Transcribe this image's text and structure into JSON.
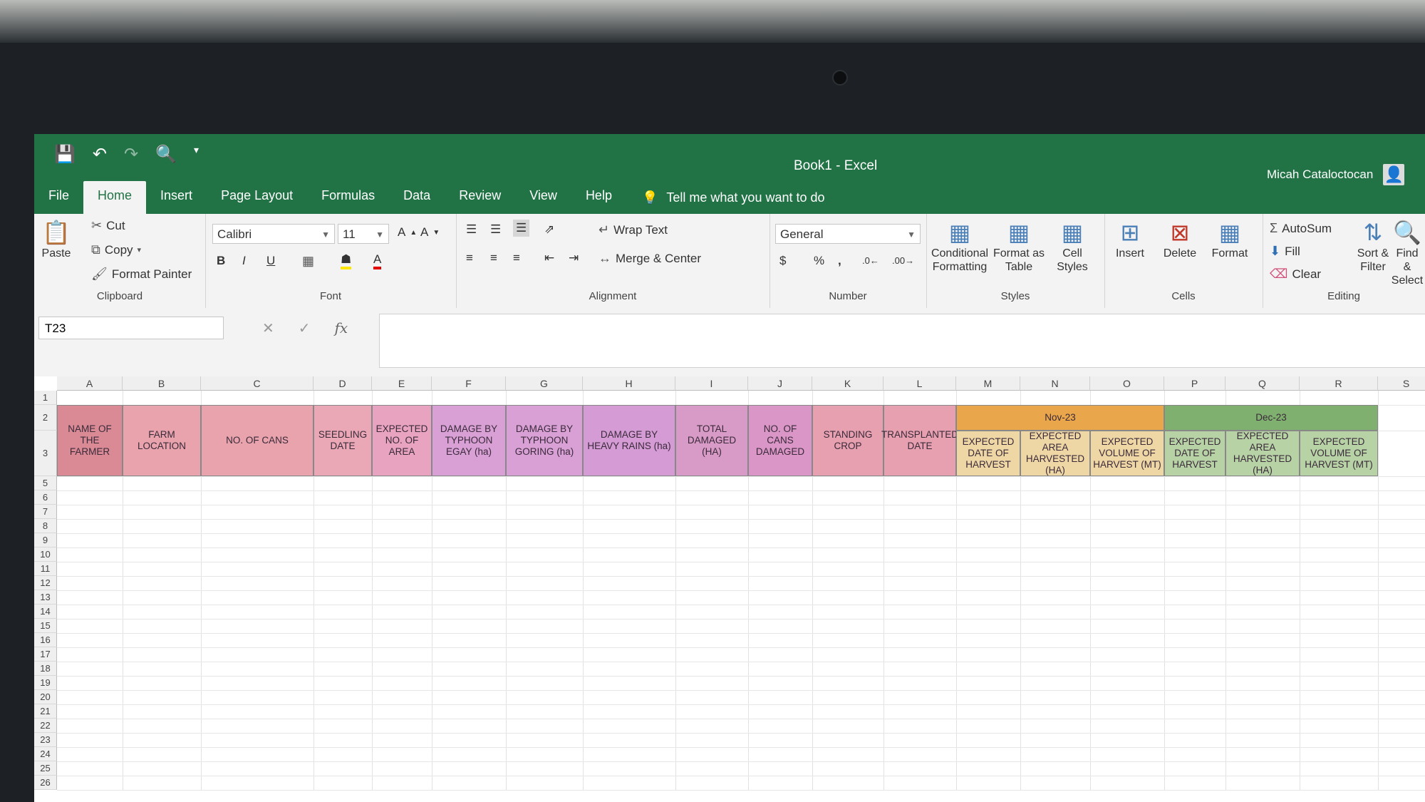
{
  "window": {
    "title": "Book1  -  Excel",
    "user": "Micah Cataloctocan"
  },
  "tabs": [
    "File",
    "Home",
    "Insert",
    "Page Layout",
    "Formulas",
    "Data",
    "Review",
    "View",
    "Help"
  ],
  "tell_me": "Tell me what you want to do",
  "clipboard": {
    "paste": "Paste",
    "cut": "Cut",
    "copy": "Copy",
    "format_painter": "Format Painter",
    "label": "Clipboard"
  },
  "font": {
    "name": "Calibri",
    "size": "11",
    "label": "Font"
  },
  "alignment": {
    "wrap": "Wrap Text",
    "merge": "Merge & Center",
    "label": "Alignment"
  },
  "number": {
    "format": "General",
    "label": "Number"
  },
  "styles": {
    "conditional": "Conditional Formatting",
    "format_table": "Format as Table",
    "cell_styles": "Cell Styles",
    "label": "Styles"
  },
  "cells": {
    "insert": "Insert",
    "delete": "Delete",
    "format": "Format",
    "label": "Cells"
  },
  "editing": {
    "autosum": "AutoSum",
    "fill": "Fill",
    "clear": "Clear",
    "sort": "Sort & Filter",
    "find": "Find & Select",
    "label": "Editing"
  },
  "name_box": "T23",
  "columns": [
    "A",
    "B",
    "C",
    "D",
    "E",
    "F",
    "G",
    "H",
    "I",
    "J",
    "K",
    "L",
    "M",
    "N",
    "O",
    "P",
    "Q",
    "R",
    "S"
  ],
  "rows": [
    "1",
    "2",
    "3",
    "5",
    "6",
    "7",
    "8",
    "9",
    "10",
    "11",
    "12",
    "13",
    "14",
    "15",
    "16",
    "17",
    "18",
    "19",
    "20",
    "21",
    "22",
    "23",
    "24",
    "25",
    "26"
  ],
  "headers": [
    {
      "text": "NAME OF THE FARMER",
      "color": "#d98a95"
    },
    {
      "text": "FARM LOCATION",
      "color": "#e8a3ad"
    },
    {
      "text": "NO. OF CANS",
      "color": "#e8a3ad"
    },
    {
      "text": "SEEDLING DATE",
      "color": "#eaa8b6"
    },
    {
      "text": "EXPECTED NO. OF AREA",
      "color": "#e7a3bf"
    },
    {
      "text": "DAMAGE BY TYPHOON EGAY (ha)",
      "color": "#d9a0d6"
    },
    {
      "text": "DAMAGE BY TYPHOON GORING (ha)",
      "color": "#d9a0d6"
    },
    {
      "text": "DAMAGE BY HEAVY RAINS (ha)",
      "color": "#d49bd4"
    },
    {
      "text": "TOTAL DAMAGED (HA)",
      "color": "#d89ac6"
    },
    {
      "text": "NO. OF CANS DAMAGED",
      "color": "#d996c6"
    },
    {
      "text": "STANDING CROP",
      "color": "#e6a0b0"
    },
    {
      "text": "TRANSPLANTED DATE",
      "color": "#e6a0b0"
    }
  ],
  "nov": {
    "label": "Nov-23",
    "color": "#e9a64a",
    "sub": [
      "EXPECTED DATE OF HARVEST",
      "EXPECTED AREA HARVESTED (HA)",
      "EXPECTED VOLUME OF HARVEST (MT)"
    ],
    "sub_color": "#efd7a5"
  },
  "dec": {
    "label": "Dec-23",
    "color": "#7fb06f",
    "sub": [
      "EXPECTED DATE OF HARVEST",
      "EXPECTED AREA HARVESTED (HA)",
      "EXPECTED VOLUME OF HARVEST (MT)"
    ],
    "sub_color": "#b7d3a6"
  }
}
